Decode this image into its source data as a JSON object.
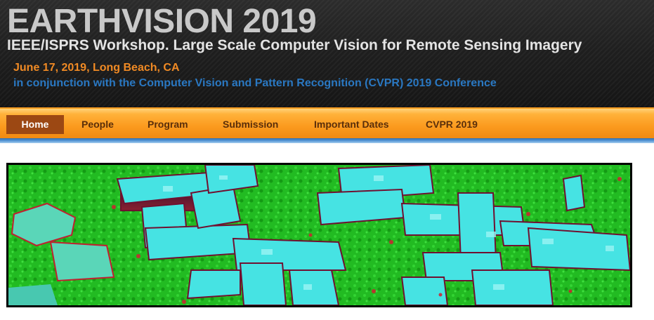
{
  "header": {
    "title": "EARTHVISION 2019",
    "subtitle": "IEEE/ISPRS Workshop. Large Scale Computer Vision for Remote Sensing Imagery",
    "date_location": "June 17, 2019, Long Beach, CA",
    "conjunction": "in conjunction with the Computer Vision and Pattern Recognition (CVPR) 2019 Conference"
  },
  "nav": {
    "items": [
      {
        "label": "Home",
        "active": true
      },
      {
        "label": "People",
        "active": false
      },
      {
        "label": "Program",
        "active": false
      },
      {
        "label": "Submission",
        "active": false
      },
      {
        "label": "Important Dates",
        "active": false
      },
      {
        "label": "CVPR 2019",
        "active": false
      }
    ]
  },
  "colors": {
    "title": "#c9c9c9",
    "date": "#f08a24",
    "conjunction": "#2a78c2",
    "nav_orange": "#fb9a1e",
    "nav_active": "#9c4813",
    "banner_ground": "#22bb22",
    "banner_buildings": "#40e0e0"
  }
}
